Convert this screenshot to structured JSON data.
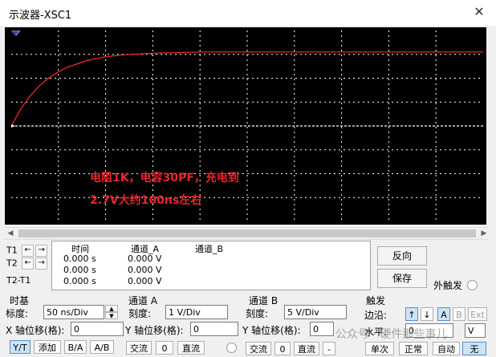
{
  "window": {
    "title": "示波器-XSC1"
  },
  "annotation": {
    "line1": "电阻1K，电容30PF，充电到",
    "line2": "2.7V大约100ns左右",
    "color": "#e8262b"
  },
  "cursors": {
    "t1": "T1",
    "t2": "T2",
    "t2t1": "T2-T1"
  },
  "measurements": {
    "headers": {
      "time": "时间",
      "channel_a": "通道_A",
      "channel_b": "通道_B"
    },
    "rows": [
      {
        "time": "0.000 s",
        "a": "0.000 V",
        "b": ""
      },
      {
        "time": "0.000 s",
        "a": "0.000 V",
        "b": ""
      },
      {
        "time": "0.000 s",
        "a": "0.000 V",
        "b": ""
      }
    ]
  },
  "buttons": {
    "reverse": "反向",
    "save": "保存"
  },
  "ext_trigger": {
    "label": "外触发"
  },
  "timebase": {
    "title": "时基",
    "scale_label": "标度:",
    "scale_value": "50 ns/Div",
    "xpos_label": "X 轴位移(格):",
    "xpos_value": "0",
    "modes": [
      "Y/T",
      "添加",
      "B/A",
      "A/B"
    ]
  },
  "channel_a": {
    "title": "通道 A",
    "scale_label": "刻度:",
    "scale_value": "1  V/Div",
    "ypos_label": "Y 轴位移(格):",
    "ypos_value": "0",
    "coupling": [
      "交流",
      "0",
      "直流"
    ]
  },
  "channel_b": {
    "title": "通道 B",
    "scale_label": "刻度:",
    "scale_value": "5  V/Div",
    "ypos_label": "Y 轴位移(格):",
    "ypos_value": "0",
    "coupling": [
      "交流",
      "0",
      "直流",
      "-"
    ]
  },
  "trigger": {
    "title": "触发",
    "edge_label": "边沿:",
    "edge_buttons": [
      "↑",
      "↓",
      "A",
      "B",
      "Ext"
    ],
    "level_label": "水平:",
    "level_value": "0",
    "level_unit": "V",
    "modes": [
      "单次",
      "正常",
      "自动",
      "无"
    ]
  },
  "watermark": {
    "text": "公众号 · 硬件那些事儿"
  },
  "colors": {
    "trace": "#ff2a2a",
    "grid": "#ffffff",
    "background": "#000000",
    "marker": "#8a6ad8"
  },
  "chart_data": {
    "type": "line",
    "x_unit": "ns",
    "y_unit": "V",
    "x_scale_per_div": 50,
    "y_scale_per_div": 1,
    "x_divisions": 10,
    "y_divisions": 8,
    "xlim": [
      0,
      500
    ],
    "ylim": [
      -4,
      4
    ],
    "grid": true,
    "series": [
      {
        "x": [
          0,
          10,
          20,
          30,
          40,
          50,
          60,
          80,
          100,
          120,
          150,
          200,
          250,
          300,
          400,
          500
        ],
        "y": [
          0,
          0.71,
          1.26,
          1.69,
          2.02,
          2.27,
          2.47,
          2.74,
          2.9,
          2.98,
          3.05,
          3.1,
          3.1,
          3.1,
          3.1,
          3.1
        ]
      }
    ]
  }
}
